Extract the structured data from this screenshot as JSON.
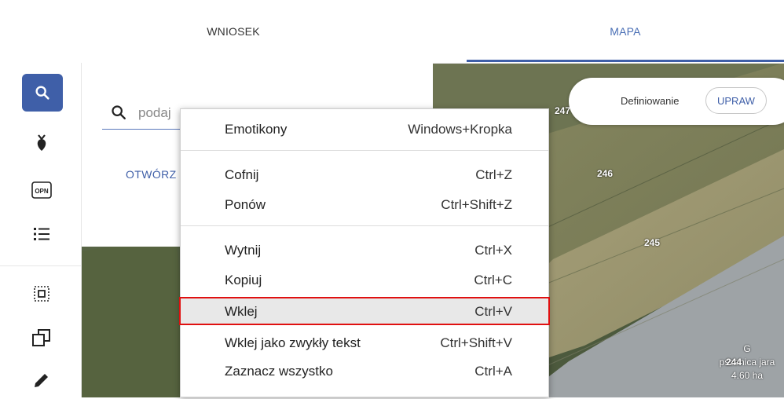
{
  "tabs": {
    "wniosek": "WNIOSEK",
    "mapa": "MAPA"
  },
  "sidebar": {
    "items": [
      {
        "name": "search-icon"
      },
      {
        "name": "plant-icon"
      },
      {
        "name": "opn-icon",
        "label": "OPN"
      },
      {
        "name": "list-icon"
      },
      {
        "name": "select-area-icon"
      },
      {
        "name": "copy-icon"
      },
      {
        "name": "pencil-icon"
      }
    ]
  },
  "search": {
    "value": "podaj",
    "placeholder": "podaj"
  },
  "panel": {
    "open_link": "OTWÓRZ"
  },
  "map": {
    "parcels": [
      "247",
      "246",
      "245"
    ],
    "legend": {
      "text": "Definiowanie",
      "button": "UPRAW"
    },
    "parcel_info": {
      "letter": "G",
      "crop": "pszenica jara",
      "number": "244",
      "area": "4.60 ha"
    }
  },
  "context_menu": {
    "items": [
      {
        "label": "Emotikony",
        "shortcut": "Windows+Kropka"
      },
      {
        "label": "Cofnij",
        "shortcut": "Ctrl+Z"
      },
      {
        "label": "Ponów",
        "shortcut": "Ctrl+Shift+Z"
      },
      {
        "label": "Wytnij",
        "shortcut": "Ctrl+X"
      },
      {
        "label": "Kopiuj",
        "shortcut": "Ctrl+C"
      },
      {
        "label": "Wklej",
        "shortcut": "Ctrl+V"
      },
      {
        "label": "Wklej jako zwykły tekst",
        "shortcut": "Ctrl+Shift+V"
      },
      {
        "label": "Zaznacz wszystko",
        "shortcut": "Ctrl+A"
      }
    ],
    "highlighted_index": 5
  },
  "colors": {
    "accent": "#3f5fa8",
    "highlight_border": "#e01010"
  }
}
